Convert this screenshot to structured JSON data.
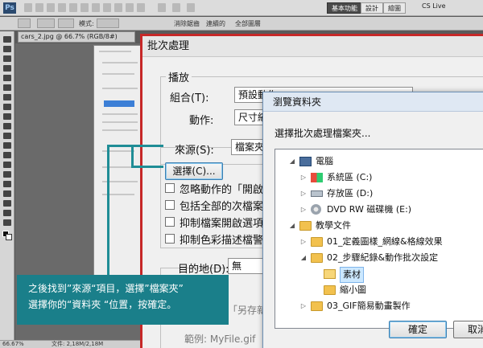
{
  "photoshop": {
    "logo": "Ps",
    "workspace_tabs": [
      "基本功能",
      "設計",
      "繪圖"
    ],
    "cs_live": "CS Live",
    "options": {
      "label1": "模式:",
      "label2": "消除鋸齒",
      "label3": "連續的",
      "label4": "全部圖層"
    },
    "document_tab": "cars_2.jpg @ 66.7% (RGB/8#)",
    "status_zoom": "66.67%",
    "status_doc": "文件: 2,18M/2,18M"
  },
  "batch_dialog": {
    "title": "批次處理",
    "play_group": "播放",
    "set_label": "組合(T):",
    "set_value": "預設動作",
    "action_label": "動作:",
    "action_value": "尺寸縮小",
    "source_label": "來源(S):",
    "source_value": "檔案夾",
    "choose_button": "選擇(C)...",
    "checkboxes": [
      "忽略動作的「開啟」",
      "包括全部的次檔案夾",
      "抑制檔案開啟選項對",
      "抑制色彩描述檔警告"
    ],
    "destination_label": "目的地(D):",
    "destination_value": "無",
    "save_as_hint": "「另存新",
    "example": "範例: MyFile.gif"
  },
  "browse_dialog": {
    "title": "瀏覽資料夾",
    "prompt": "選擇批次處理檔案夾...",
    "tree": [
      {
        "label": "電腦",
        "icon": "computer-icon",
        "toggle": "◢",
        "level": 0
      },
      {
        "label": "系統區 (C:)",
        "icon": "windows-drive-icon",
        "toggle": "▷",
        "level": 1
      },
      {
        "label": "存放區 (D:)",
        "icon": "drive-icon",
        "toggle": "▷",
        "level": 1
      },
      {
        "label": "DVD RW 磁碟機 (E:)",
        "icon": "dvd-icon",
        "toggle": "▷",
        "level": 1
      },
      {
        "label": "教學文件",
        "icon": "folder-icon",
        "toggle": "◢",
        "level": 0
      },
      {
        "label": "01_定義圖樣_網線&格線效果",
        "icon": "folder-icon",
        "toggle": "▷",
        "level": 1
      },
      {
        "label": "02_步驟紀錄&動作批次設定",
        "icon": "folder-icon",
        "toggle": "◢",
        "level": 1
      },
      {
        "label": "素材",
        "icon": "folder-open-icon",
        "toggle": "",
        "level": 2,
        "selected": true
      },
      {
        "label": "縮小圖",
        "icon": "folder-icon",
        "toggle": "",
        "level": 2
      },
      {
        "label": "03_GIF簡易動畫製作",
        "icon": "folder-icon",
        "toggle": "▷",
        "level": 1
      }
    ],
    "ok_button": "確定",
    "cancel_button": "取消"
  },
  "callout": {
    "line1": "之後找到”來源“項目，選擇”檔案夾”",
    "line2": "選擇你的“資料夾 “位置，按確定。"
  },
  "colors": {
    "callout": "#1a7f8a",
    "dialog_border": "#c62828",
    "selection": "#cce8ff"
  }
}
